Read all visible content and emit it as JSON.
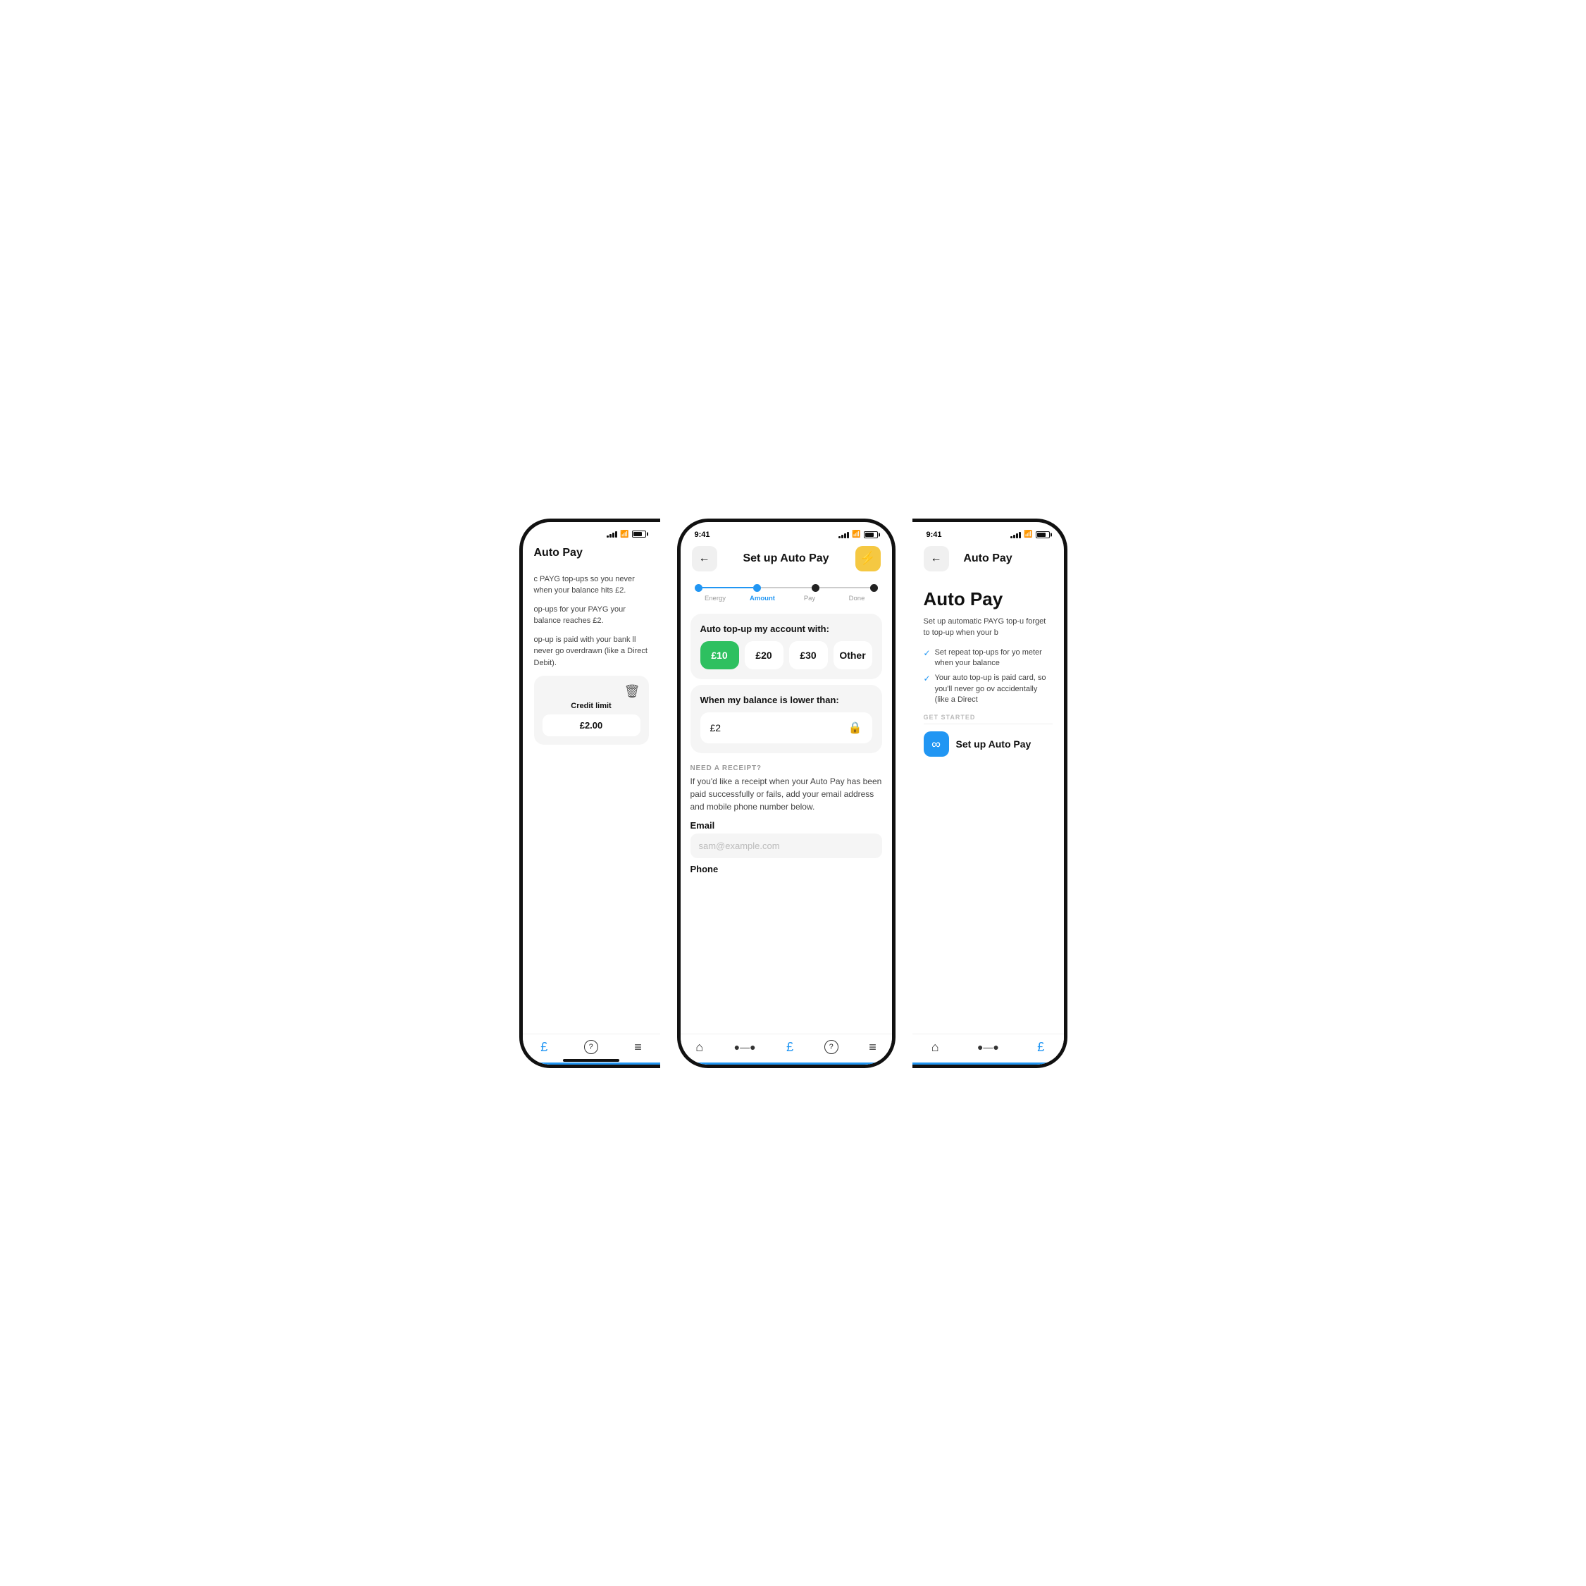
{
  "left_phone": {
    "title": "Auto Pay",
    "status_time": "",
    "text1": "c PAYG top-ups so you never when your balance hits £2.",
    "text2": "op-ups for your PAYG your balance reaches £2.",
    "text3": "op-up is paid with your bank ll never go overdrawn (like a Direct Debit).",
    "credit_label": "Credit limit",
    "credit_value": "£2.00",
    "nav_items": [
      "£",
      "?",
      "≡"
    ]
  },
  "center_phone": {
    "status_time": "9:41",
    "nav_title": "Set up Auto Pay",
    "nav_back": "←",
    "nav_action": "⚡",
    "steps": [
      "Energy",
      "Amount",
      "Pay",
      "Done"
    ],
    "active_step": 1,
    "section1_title": "Auto top-up my account with:",
    "amounts": [
      "£10",
      "£20",
      "£30",
      "Other"
    ],
    "selected_amount": 0,
    "section2_title": "When my balance is lower than:",
    "balance_value": "£2",
    "receipt_heading": "NEED A RECEIPT?",
    "receipt_text": "If you'd like a receipt when your Auto Pay has been paid successfully or fails, add your email address and mobile phone number below.",
    "email_label": "Email",
    "email_placeholder": "sam@example.com",
    "phone_label": "Phone",
    "nav_items": [
      "🏠",
      "⬤—⬤",
      "£",
      "?",
      "≡"
    ]
  },
  "right_phone": {
    "status_time": "9:41",
    "nav_back": "←",
    "nav_title": "Auto Pay",
    "big_title": "Auto Pay",
    "description": "Set up automatic PAYG top-u forget to top-up when your b",
    "checks": [
      "Set repeat top-ups for yo meter when your balance",
      "Your auto top-up is paid card, so you'll never go ov accidentally (like a Direct"
    ],
    "get_started_label": "GET STARTED",
    "setup_label": "Set up Auto Pay",
    "nav_items": [
      "🏠",
      "⬤—⬤",
      "£"
    ]
  },
  "colors": {
    "green": "#2ec060",
    "blue": "#2196f3",
    "yellow": "#f5c842",
    "background": "#ffffff"
  }
}
